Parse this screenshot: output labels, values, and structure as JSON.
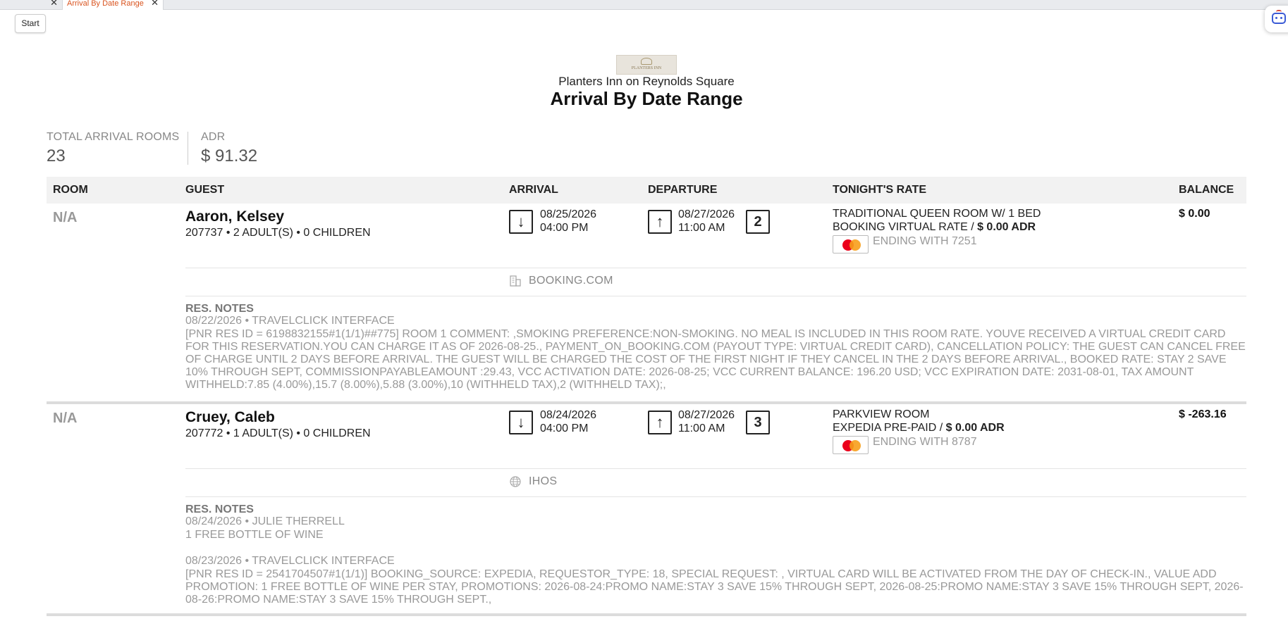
{
  "tabs": [
    {
      "label": "",
      "close": "✕"
    },
    {
      "label": "Arrival By Date Range",
      "close": "✕"
    }
  ],
  "start_button": "Start",
  "header": {
    "logo_text": "PLANTERS INN",
    "hotel_name": "Planters Inn on Reynolds Square",
    "title": "Arrival By Date Range"
  },
  "stats": {
    "total_label": "TOTAL ARRIVAL ROOMS",
    "total_value": "23",
    "adr_label": "ADR",
    "adr_value": "$ 91.32"
  },
  "columns": {
    "room": "ROOM",
    "guest": "GUEST",
    "arrival": "ARRIVAL",
    "departure": "DEPARTURE",
    "rate": "TONIGHT'S RATE",
    "balance": "BALANCE"
  },
  "reservations": [
    {
      "room": "N/A",
      "guest_name": "Aaron, Kelsey",
      "guest_sub": "207737  • 2 ADULT(S)  • 0 CHILDREN",
      "arrival_date": "08/25/2026",
      "arrival_time": "04:00 PM",
      "departure_date": "08/27/2026",
      "departure_time": "11:00 AM",
      "nights": "2",
      "room_type": "TRADITIONAL QUEEN ROOM W/ 1 BED",
      "rate_plan": "BOOKING VIRTUAL RATE / ",
      "rate_adr": "$ 0.00 ADR",
      "card_ending": "ENDING WITH 7251",
      "balance": "$ 0.00",
      "source": "BOOKING.COM",
      "notes_label": "RES. NOTES",
      "notes": [
        {
          "meta": "08/22/2026 • TRAVELCLICK INTERFACE",
          "text": "[PNR RES ID = 6198832155#1(1/1)##775] ROOM 1 COMMENT: ,SMOKING PREFERENCE:NON-SMOKING. NO MEAL IS INCLUDED IN THIS ROOM RATE. YOUVE RECEIVED A VIRTUAL CREDIT CARD FOR THIS RESERVATION.YOU CAN CHARGE IT AS OF 2026-08-25., PAYMENT_ON_BOOKING.COM (PAYOUT TYPE: VIRTUAL CREDIT CARD), CANCELLATION POLICY: THE GUEST CAN CANCEL FREE OF CHARGE UNTIL 2 DAYS BEFORE ARRIVAL. THE GUEST WILL BE CHARGED THE COST OF THE FIRST NIGHT IF THEY CANCEL IN THE 2 DAYS BEFORE ARRIVAL., BOOKED RATE: STAY 2 SAVE 10% THROUGH SEPT, COMMISSIONPAYABLEAMOUNT :29.43, VCC ACTIVATION DATE: 2026-08-25; VCC CURRENT BALANCE: 196.20 USD; VCC EXPIRATION DATE: 2031-08-01, TAX AMOUNT WITHHELD:7.85 (4.00%),15.7 (8.00%),5.88 (3.00%),10 (WITHHELD TAX),2 (WITHHELD TAX);,"
        }
      ]
    },
    {
      "room": "N/A",
      "guest_name": "Cruey, Caleb",
      "guest_sub": "207772  • 1 ADULT(S)  • 0 CHILDREN",
      "arrival_date": "08/24/2026",
      "arrival_time": "04:00 PM",
      "departure_date": "08/27/2026",
      "departure_time": "11:00 AM",
      "nights": "3",
      "room_type": "PARKVIEW ROOM",
      "rate_plan": "EXPEDIA PRE-PAID / ",
      "rate_adr": "$ 0.00 ADR",
      "card_ending": "ENDING WITH 8787",
      "balance": "$ -263.16",
      "source": "IHOS",
      "notes_label": "RES. NOTES",
      "notes": [
        {
          "meta": "08/24/2026 • JULIE THERRELL",
          "text": "1 FREE BOTTLE OF WINE"
        },
        {
          "meta": "08/23/2026 • TRAVELCLICK INTERFACE",
          "text": "[PNR RES ID = 2541704507#1(1/1)] BOOKING_SOURCE: EXPEDIA, REQUESTOR_TYPE: 18, SPECIAL REQUEST: , VIRTUAL CARD WILL BE ACTIVATED FROM THE DAY OF CHECK-IN., VALUE ADD PROMOTION: 1 FREE BOTTLE OF WINE PER STAY, PROMOTIONS: 2026-08-24:PROMO NAME:STAY 3 SAVE 15% THROUGH SEPT, 2026-08-25:PROMO NAME:STAY 3 SAVE 15% THROUGH SEPT, 2026-08-26:PROMO NAME:STAY 3 SAVE 15% THROUGH SEPT.,"
        }
      ]
    }
  ],
  "icons": {
    "arrival": "↓",
    "departure": "↑"
  },
  "colors": {
    "active_tab": "#d9531e",
    "header_bg": "#f2f2f2",
    "muted_text": "#999999",
    "mastercard_red": "#eb001b",
    "mastercard_yellow": "#f79e1b"
  }
}
